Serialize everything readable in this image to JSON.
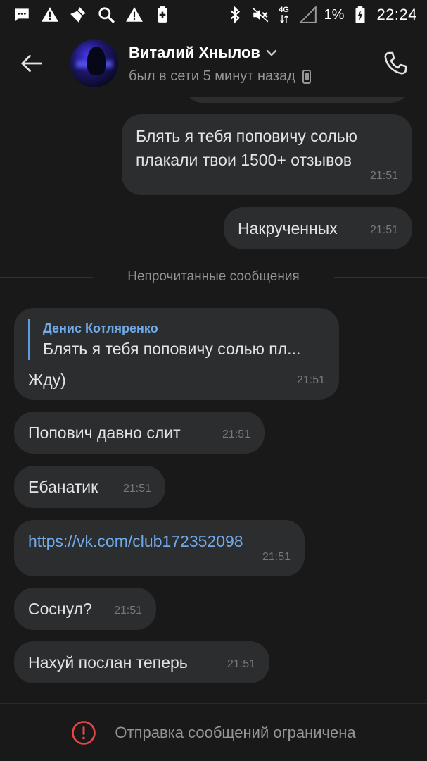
{
  "status_bar": {
    "battery_percent": "1%",
    "time": "22:24",
    "network": "4G",
    "icons_left": [
      "message-icon",
      "alert-icon",
      "clean-icon",
      "search-icon",
      "alert-icon",
      "battery-saver-icon"
    ],
    "icons_right": [
      "bluetooth-icon",
      "mute-icon",
      "signal-icon",
      "battery-charging-icon"
    ]
  },
  "header": {
    "contact_name": "Виталий Хнылов",
    "contact_status": "был в сети 5 минут назад",
    "icons": [
      "back-arrow-icon",
      "chevron-down-icon",
      "mobile-device-icon",
      "phone-call-icon"
    ]
  },
  "messages": {
    "outgoing": [
      {
        "text": "Блять я тебя поповичу солью плакали твои 1500+ отзывов",
        "time": "21:51"
      },
      {
        "text": "Накрученных",
        "time": "21:51"
      }
    ],
    "unread_separator": "Непрочитанные сообщения",
    "incoming": [
      {
        "reply_author": "Денис Котляренко",
        "reply_preview": "Блять я тебя поповичу солью пл...",
        "text": "Жду)",
        "time": "21:51"
      },
      {
        "text": "Попович давно слит",
        "time": "21:51"
      },
      {
        "text": "Ебанатик",
        "time": "21:51"
      },
      {
        "text": "https://vk.com/club172352098",
        "time": "21:51"
      },
      {
        "text": "Соснул?",
        "time": "21:51"
      },
      {
        "text": "Нахуй послан теперь",
        "time": "21:51"
      }
    ]
  },
  "footer": {
    "text": "Отправка сообщений ограничена",
    "icon": "warning-circle-icon"
  },
  "colors": {
    "background": "#19191a",
    "bubble": "#2c2d2e",
    "link": "#71aaeb",
    "warning": "#e64646",
    "secondary_text": "#939599"
  }
}
